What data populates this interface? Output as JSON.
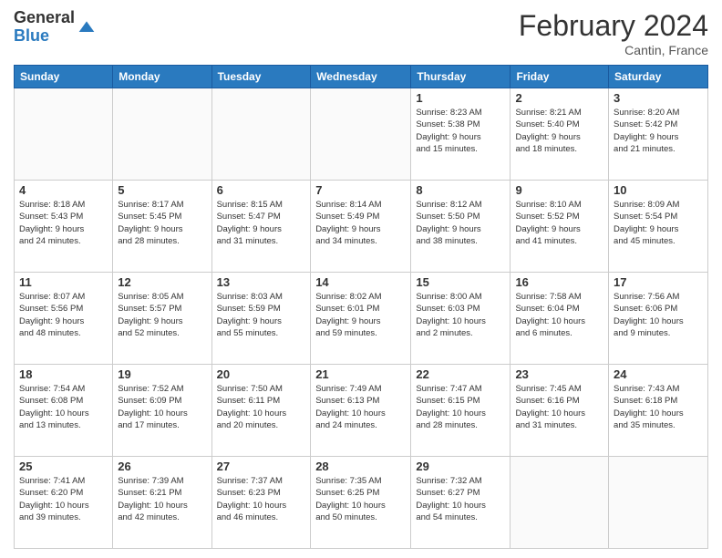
{
  "header": {
    "logo_line1": "General",
    "logo_line2": "Blue",
    "title": "February 2024",
    "subtitle": "Cantin, France"
  },
  "weekdays": [
    "Sunday",
    "Monday",
    "Tuesday",
    "Wednesday",
    "Thursday",
    "Friday",
    "Saturday"
  ],
  "weeks": [
    [
      {
        "day": "",
        "info": ""
      },
      {
        "day": "",
        "info": ""
      },
      {
        "day": "",
        "info": ""
      },
      {
        "day": "",
        "info": ""
      },
      {
        "day": "1",
        "info": "Sunrise: 8:23 AM\nSunset: 5:38 PM\nDaylight: 9 hours\nand 15 minutes."
      },
      {
        "day": "2",
        "info": "Sunrise: 8:21 AM\nSunset: 5:40 PM\nDaylight: 9 hours\nand 18 minutes."
      },
      {
        "day": "3",
        "info": "Sunrise: 8:20 AM\nSunset: 5:42 PM\nDaylight: 9 hours\nand 21 minutes."
      }
    ],
    [
      {
        "day": "4",
        "info": "Sunrise: 8:18 AM\nSunset: 5:43 PM\nDaylight: 9 hours\nand 24 minutes."
      },
      {
        "day": "5",
        "info": "Sunrise: 8:17 AM\nSunset: 5:45 PM\nDaylight: 9 hours\nand 28 minutes."
      },
      {
        "day": "6",
        "info": "Sunrise: 8:15 AM\nSunset: 5:47 PM\nDaylight: 9 hours\nand 31 minutes."
      },
      {
        "day": "7",
        "info": "Sunrise: 8:14 AM\nSunset: 5:49 PM\nDaylight: 9 hours\nand 34 minutes."
      },
      {
        "day": "8",
        "info": "Sunrise: 8:12 AM\nSunset: 5:50 PM\nDaylight: 9 hours\nand 38 minutes."
      },
      {
        "day": "9",
        "info": "Sunrise: 8:10 AM\nSunset: 5:52 PM\nDaylight: 9 hours\nand 41 minutes."
      },
      {
        "day": "10",
        "info": "Sunrise: 8:09 AM\nSunset: 5:54 PM\nDaylight: 9 hours\nand 45 minutes."
      }
    ],
    [
      {
        "day": "11",
        "info": "Sunrise: 8:07 AM\nSunset: 5:56 PM\nDaylight: 9 hours\nand 48 minutes."
      },
      {
        "day": "12",
        "info": "Sunrise: 8:05 AM\nSunset: 5:57 PM\nDaylight: 9 hours\nand 52 minutes."
      },
      {
        "day": "13",
        "info": "Sunrise: 8:03 AM\nSunset: 5:59 PM\nDaylight: 9 hours\nand 55 minutes."
      },
      {
        "day": "14",
        "info": "Sunrise: 8:02 AM\nSunset: 6:01 PM\nDaylight: 9 hours\nand 59 minutes."
      },
      {
        "day": "15",
        "info": "Sunrise: 8:00 AM\nSunset: 6:03 PM\nDaylight: 10 hours\nand 2 minutes."
      },
      {
        "day": "16",
        "info": "Sunrise: 7:58 AM\nSunset: 6:04 PM\nDaylight: 10 hours\nand 6 minutes."
      },
      {
        "day": "17",
        "info": "Sunrise: 7:56 AM\nSunset: 6:06 PM\nDaylight: 10 hours\nand 9 minutes."
      }
    ],
    [
      {
        "day": "18",
        "info": "Sunrise: 7:54 AM\nSunset: 6:08 PM\nDaylight: 10 hours\nand 13 minutes."
      },
      {
        "day": "19",
        "info": "Sunrise: 7:52 AM\nSunset: 6:09 PM\nDaylight: 10 hours\nand 17 minutes."
      },
      {
        "day": "20",
        "info": "Sunrise: 7:50 AM\nSunset: 6:11 PM\nDaylight: 10 hours\nand 20 minutes."
      },
      {
        "day": "21",
        "info": "Sunrise: 7:49 AM\nSunset: 6:13 PM\nDaylight: 10 hours\nand 24 minutes."
      },
      {
        "day": "22",
        "info": "Sunrise: 7:47 AM\nSunset: 6:15 PM\nDaylight: 10 hours\nand 28 minutes."
      },
      {
        "day": "23",
        "info": "Sunrise: 7:45 AM\nSunset: 6:16 PM\nDaylight: 10 hours\nand 31 minutes."
      },
      {
        "day": "24",
        "info": "Sunrise: 7:43 AM\nSunset: 6:18 PM\nDaylight: 10 hours\nand 35 minutes."
      }
    ],
    [
      {
        "day": "25",
        "info": "Sunrise: 7:41 AM\nSunset: 6:20 PM\nDaylight: 10 hours\nand 39 minutes."
      },
      {
        "day": "26",
        "info": "Sunrise: 7:39 AM\nSunset: 6:21 PM\nDaylight: 10 hours\nand 42 minutes."
      },
      {
        "day": "27",
        "info": "Sunrise: 7:37 AM\nSunset: 6:23 PM\nDaylight: 10 hours\nand 46 minutes."
      },
      {
        "day": "28",
        "info": "Sunrise: 7:35 AM\nSunset: 6:25 PM\nDaylight: 10 hours\nand 50 minutes."
      },
      {
        "day": "29",
        "info": "Sunrise: 7:32 AM\nSunset: 6:27 PM\nDaylight: 10 hours\nand 54 minutes."
      },
      {
        "day": "",
        "info": ""
      },
      {
        "day": "",
        "info": ""
      }
    ]
  ]
}
